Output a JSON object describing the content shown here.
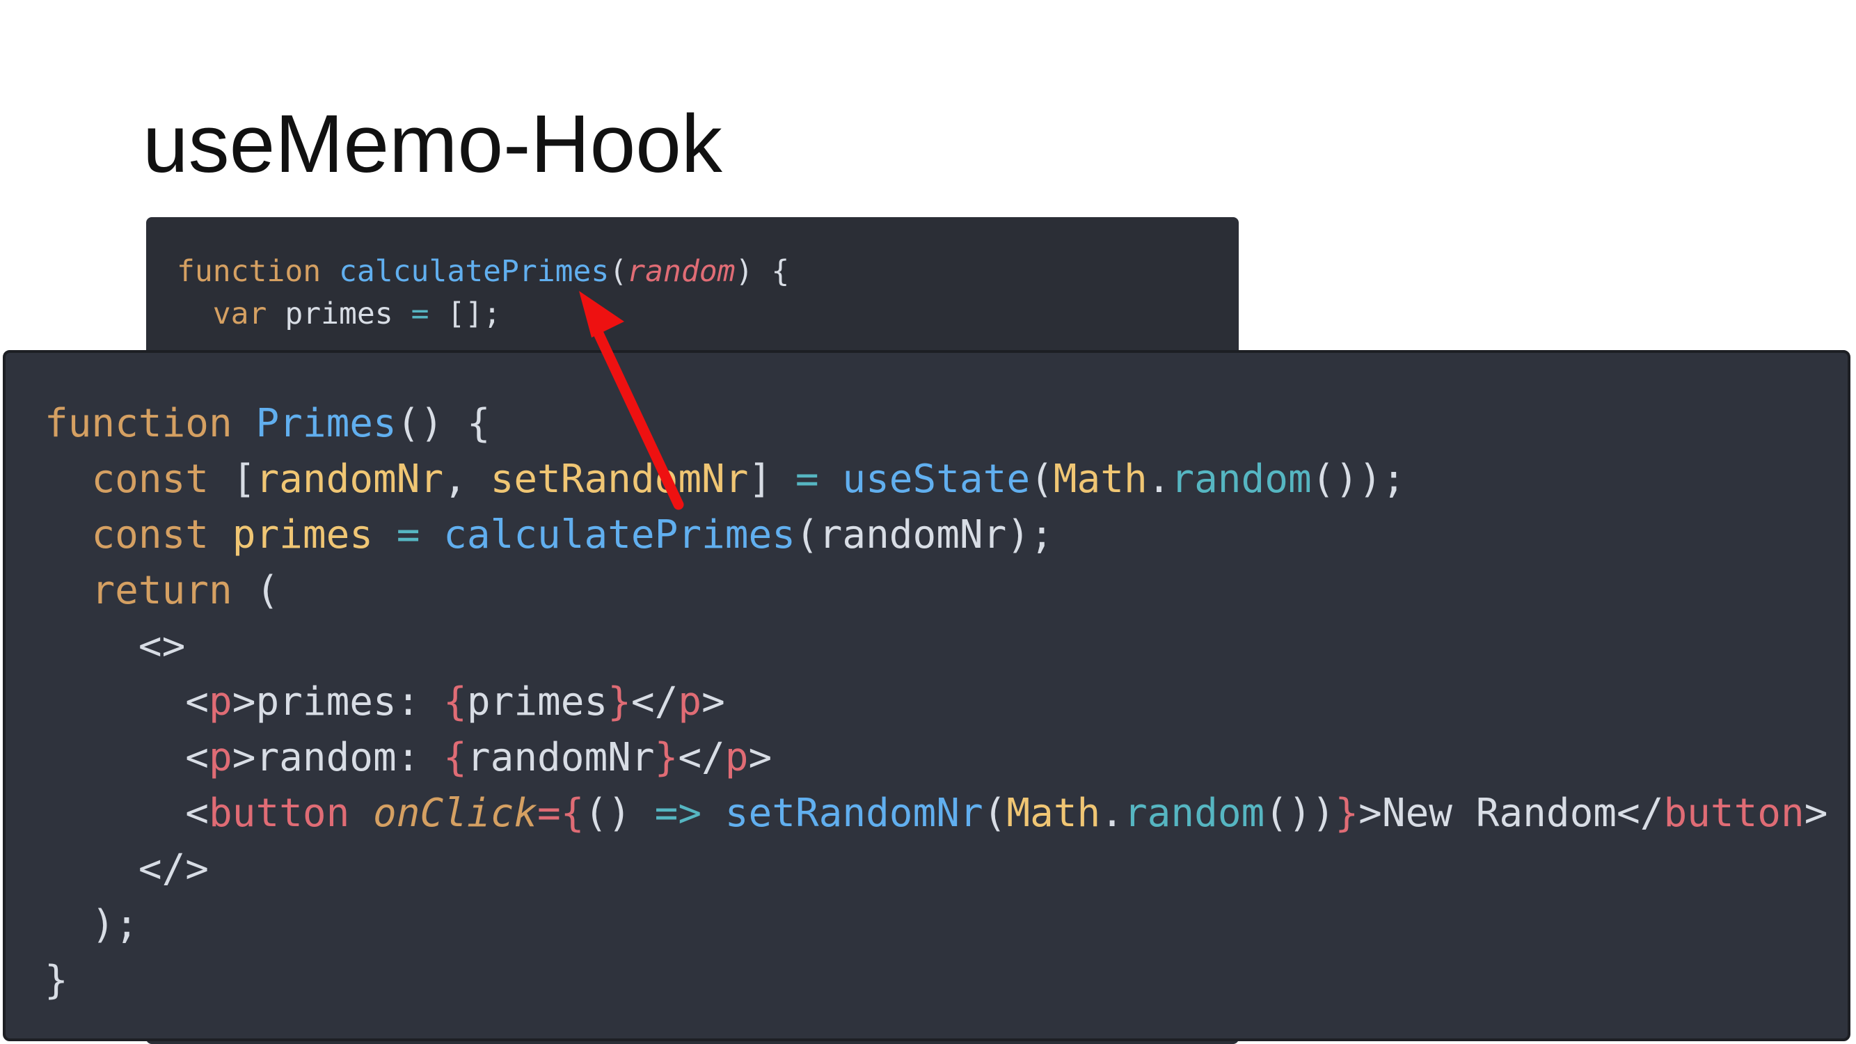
{
  "slide": {
    "title": "useMemo-Hook"
  },
  "back_code": {
    "lines": [
      [
        {
          "c": "t-kw",
          "t": "function"
        },
        {
          "c": "t-pl",
          "t": " "
        },
        {
          "c": "t-fn",
          "t": "calculatePrimes"
        },
        {
          "c": "t-pl",
          "t": "("
        },
        {
          "c": "t-param",
          "t": "random"
        },
        {
          "c": "t-pl",
          "t": ") {"
        }
      ],
      [
        {
          "c": "t-pl",
          "t": "  "
        },
        {
          "c": "t-kw",
          "t": "var"
        },
        {
          "c": "t-pl",
          "t": " primes "
        },
        {
          "c": "t-op",
          "t": "="
        },
        {
          "c": "t-pl",
          "t": " [];"
        }
      ]
    ]
  },
  "front_code": {
    "lines": [
      [
        {
          "c": "t-kw",
          "t": "function"
        },
        {
          "c": "t-pl",
          "t": " "
        },
        {
          "c": "t-fn",
          "t": "Primes"
        },
        {
          "c": "t-pl",
          "t": "() {"
        }
      ],
      [
        {
          "c": "t-pl",
          "t": "  "
        },
        {
          "c": "t-kw",
          "t": "const"
        },
        {
          "c": "t-pl",
          "t": " ["
        },
        {
          "c": "t-var",
          "t": "randomNr"
        },
        {
          "c": "t-pl",
          "t": ", "
        },
        {
          "c": "t-var",
          "t": "setRandomNr"
        },
        {
          "c": "t-pl",
          "t": "] "
        },
        {
          "c": "t-op",
          "t": "="
        },
        {
          "c": "t-pl",
          "t": " "
        },
        {
          "c": "t-fn",
          "t": "useState"
        },
        {
          "c": "t-pl",
          "t": "("
        },
        {
          "c": "t-obj",
          "t": "Math"
        },
        {
          "c": "t-pl",
          "t": "."
        },
        {
          "c": "t-op",
          "t": "random"
        },
        {
          "c": "t-pl",
          "t": "());"
        }
      ],
      [
        {
          "c": "t-pl",
          "t": "  "
        },
        {
          "c": "t-kw",
          "t": "const"
        },
        {
          "c": "t-pl",
          "t": " "
        },
        {
          "c": "t-var",
          "t": "primes"
        },
        {
          "c": "t-pl",
          "t": " "
        },
        {
          "c": "t-op",
          "t": "="
        },
        {
          "c": "t-pl",
          "t": " "
        },
        {
          "c": "t-fn",
          "t": "calculatePrimes"
        },
        {
          "c": "t-pl",
          "t": "(randomNr);"
        }
      ],
      [
        {
          "c": "t-pl",
          "t": "  "
        },
        {
          "c": "t-kw",
          "t": "return"
        },
        {
          "c": "t-pl",
          "t": " ("
        }
      ],
      [
        {
          "c": "t-pl",
          "t": "    <>"
        }
      ],
      [
        {
          "c": "t-pl",
          "t": "      <"
        },
        {
          "c": "t-tag",
          "t": "p"
        },
        {
          "c": "t-pl",
          "t": ">primes: "
        },
        {
          "c": "t-brace",
          "t": "{"
        },
        {
          "c": "t-pl",
          "t": "primes"
        },
        {
          "c": "t-brace",
          "t": "}"
        },
        {
          "c": "t-pl",
          "t": "</"
        },
        {
          "c": "t-tag",
          "t": "p"
        },
        {
          "c": "t-pl",
          "t": ">"
        }
      ],
      [
        {
          "c": "t-pl",
          "t": "      <"
        },
        {
          "c": "t-tag",
          "t": "p"
        },
        {
          "c": "t-pl",
          "t": ">random: "
        },
        {
          "c": "t-brace",
          "t": "{"
        },
        {
          "c": "t-pl",
          "t": "randomNr"
        },
        {
          "c": "t-brace",
          "t": "}"
        },
        {
          "c": "t-pl",
          "t": "</"
        },
        {
          "c": "t-tag",
          "t": "p"
        },
        {
          "c": "t-pl",
          "t": ">"
        }
      ],
      [
        {
          "c": "t-pl",
          "t": "      <"
        },
        {
          "c": "t-tag",
          "t": "button"
        },
        {
          "c": "t-pl",
          "t": " "
        },
        {
          "c": "t-attr",
          "t": "onClick"
        },
        {
          "c": "t-tag",
          "t": "="
        },
        {
          "c": "t-brace",
          "t": "{"
        },
        {
          "c": "t-pl",
          "t": "() "
        },
        {
          "c": "t-op",
          "t": "=>"
        },
        {
          "c": "t-pl",
          "t": " "
        },
        {
          "c": "t-fn",
          "t": "setRandomNr"
        },
        {
          "c": "t-pl",
          "t": "("
        },
        {
          "c": "t-obj",
          "t": "Math"
        },
        {
          "c": "t-pl",
          "t": "."
        },
        {
          "c": "t-op",
          "t": "random"
        },
        {
          "c": "t-pl",
          "t": "())"
        },
        {
          "c": "t-brace",
          "t": "}"
        },
        {
          "c": "t-pl",
          "t": ">New Random</"
        },
        {
          "c": "t-tag",
          "t": "button"
        },
        {
          "c": "t-pl",
          "t": ">"
        }
      ],
      [
        {
          "c": "t-pl",
          "t": "    </>"
        }
      ],
      [
        {
          "c": "t-pl",
          "t": "  );"
        }
      ],
      [
        {
          "c": "t-pl",
          "t": "}"
        }
      ]
    ]
  },
  "colors": {
    "arrow": "#ee1111",
    "back_panel_bg": "#2b2e36",
    "front_panel_bg": "#2f333d"
  },
  "icons": {
    "arrow": "arrow-up-icon"
  }
}
